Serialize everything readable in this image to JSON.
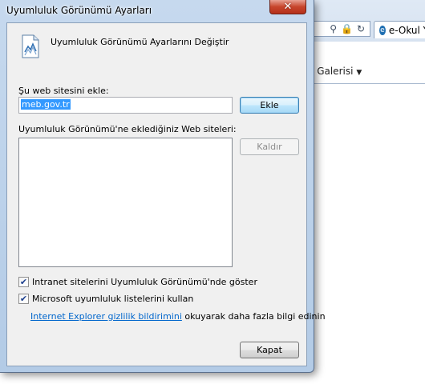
{
  "browser": {
    "tab_title": "e-Okul Y",
    "tab_icon": "ie-logo-icon",
    "gallery_label": "e Galerisi"
  },
  "dialog": {
    "title": "Uyumluluk Görünümü Ayarları",
    "close_glyph": "✕",
    "header_title": "Uyumluluk Görünümü Ayarlarını Değiştir",
    "add_label": "Şu web sitesini ekle:",
    "site_input_value": "meb.gov.tr",
    "add_button": "Ekle",
    "list_label": "Uyumluluk Görünümü'ne eklediğiniz Web siteleri:",
    "list_items": [],
    "remove_button": "Kaldır",
    "intranet_checkbox": {
      "label": "Intranet sitelerini Uyumluluk Görünümü'nde göster",
      "checked": true
    },
    "ms_lists_checkbox": {
      "label": "Microsoft uyumluluk listelerini kullan",
      "checked": true
    },
    "privacy_link": "Internet Explorer gizlilik bildirimini",
    "privacy_suffix": "okuyarak daha fazla bilgi edinin",
    "close_button": "Kapat"
  },
  "colors": {
    "link": "#0066cc",
    "selection": "#3399ff"
  }
}
